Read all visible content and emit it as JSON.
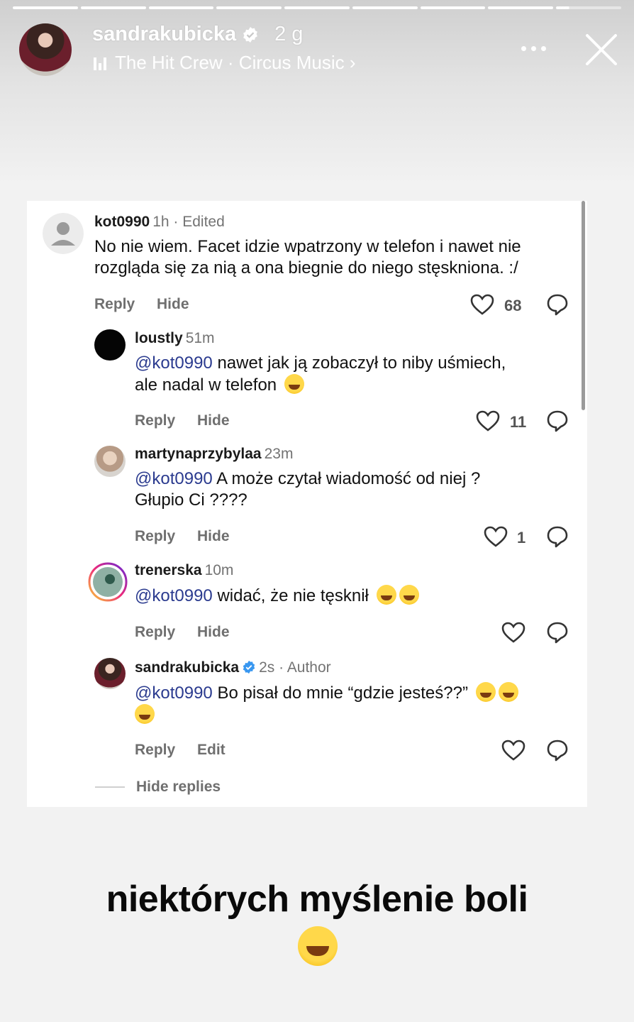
{
  "story": {
    "username": "sandrakubicka",
    "time": "2 g",
    "music": "The Hit Crew · Circus Music ›",
    "progress_segments": 9
  },
  "comments": [
    {
      "user": "kot0990",
      "meta": "1h · Edited",
      "text_lines": [
        "No nie wiem. Facet idzie wpatrzony w telefon i nawet nie",
        "rozgląda się za nią a ona biegnie do niego stęskniona. :/"
      ],
      "reply": "Reply",
      "second_action": "Hide",
      "likes": "68"
    },
    {
      "user": "loustly",
      "meta": "51m",
      "mention": "@kot0990",
      "text_line1": " nawet jak ją zobaczył to niby uśmiech,",
      "text_line2": "ale nadal w telefon",
      "reply": "Reply",
      "second_action": "Hide",
      "likes": "11"
    },
    {
      "user": "martynaprzybylaa",
      "meta": "23m",
      "mention": "@kot0990",
      "text_line1": " A może czytał wiadomość od niej ?",
      "text_line2": "Głupio Ci ????",
      "reply": "Reply",
      "second_action": "Hide",
      "likes": "1"
    },
    {
      "user": "trenerska",
      "meta": "10m",
      "mention": "@kot0990",
      "text_line1": " widać, że nie tęsknił",
      "reply": "Reply",
      "second_action": "Hide",
      "likes": ""
    },
    {
      "user": "sandrakubicka",
      "meta": "2s · Author",
      "mention": "@kot0990",
      "text_line1": " Bo pisał do mnie “gdzie jesteś??”",
      "reply": "Reply",
      "second_action": "Edit",
      "likes": ""
    }
  ],
  "hide_replies": "Hide replies",
  "caption": "niektórych myślenie boli",
  "colors": {
    "mention": "#2b3b8f",
    "verified": "#3897f0",
    "action_grey": "#6f6f6f"
  }
}
